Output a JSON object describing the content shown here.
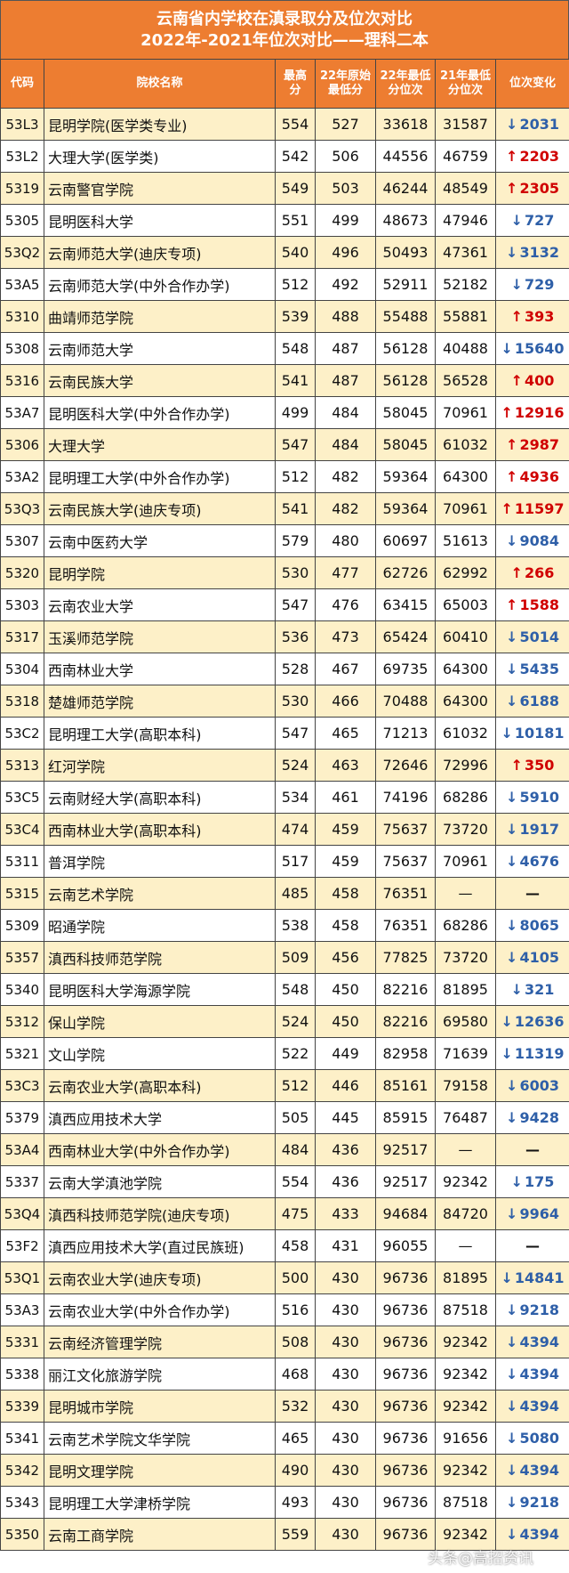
{
  "title": {
    "line1": "云南省内学校在滇录取分及位次对比",
    "line2": "2022年-2021年位次对比——理科二本"
  },
  "headers": [
    "代码",
    "院校名称",
    "最高分",
    "22年原始最低分",
    "22年最低分位次",
    "21年最低分位次",
    "位次变化"
  ],
  "colors": {
    "header": "#ed7d31",
    "stripe": "#fdf0c8",
    "up": "#d00000",
    "down": "#2e5fa8"
  },
  "watermark": "头条@高招资讯",
  "rows": [
    [
      "53L3",
      "昆明学院(医学类专业)",
      "554",
      "527",
      "33618",
      "31587",
      "down",
      "2031"
    ],
    [
      "53L2",
      "大理大学(医学类)",
      "542",
      "506",
      "44556",
      "46759",
      "up",
      "2203"
    ],
    [
      "5319",
      "云南警官学院",
      "549",
      "503",
      "46244",
      "48549",
      "up",
      "2305"
    ],
    [
      "5305",
      "昆明医科大学",
      "551",
      "499",
      "48673",
      "47946",
      "down",
      "727"
    ],
    [
      "53Q2",
      "云南师范大学(迪庆专项)",
      "540",
      "496",
      "50493",
      "47361",
      "down",
      "3132"
    ],
    [
      "53A5",
      "云南师范大学(中外合作办学)",
      "512",
      "492",
      "52911",
      "52182",
      "down",
      "729"
    ],
    [
      "5310",
      "曲靖师范学院",
      "539",
      "488",
      "55488",
      "55881",
      "up",
      "393"
    ],
    [
      "5308",
      "云南师范大学",
      "548",
      "487",
      "56128",
      "40488",
      "down",
      "15640"
    ],
    [
      "5316",
      "云南民族大学",
      "541",
      "487",
      "56128",
      "56528",
      "up",
      "400"
    ],
    [
      "53A7",
      "昆明医科大学(中外合作办学)",
      "499",
      "484",
      "58045",
      "70961",
      "up",
      "12916"
    ],
    [
      "5306",
      "大理大学",
      "547",
      "484",
      "58045",
      "61032",
      "up",
      "2987"
    ],
    [
      "53A2",
      "昆明理工大学(中外合作办学)",
      "512",
      "482",
      "59364",
      "64300",
      "up",
      "4936"
    ],
    [
      "53Q3",
      "云南民族大学(迪庆专项)",
      "541",
      "482",
      "59364",
      "70961",
      "up",
      "11597"
    ],
    [
      "5307",
      "云南中医药大学",
      "579",
      "480",
      "60697",
      "51613",
      "down",
      "9084"
    ],
    [
      "5320",
      "昆明学院",
      "530",
      "477",
      "62726",
      "62992",
      "up",
      "266"
    ],
    [
      "5303",
      "云南农业大学",
      "547",
      "476",
      "63415",
      "65003",
      "up",
      "1588"
    ],
    [
      "5317",
      "玉溪师范学院",
      "536",
      "473",
      "65424",
      "60410",
      "down",
      "5014"
    ],
    [
      "5304",
      "西南林业大学",
      "528",
      "467",
      "69735",
      "64300",
      "down",
      "5435"
    ],
    [
      "5318",
      "楚雄师范学院",
      "530",
      "466",
      "70488",
      "64300",
      "down",
      "6188"
    ],
    [
      "53C2",
      "昆明理工大学(高职本科)",
      "547",
      "465",
      "71213",
      "61032",
      "down",
      "10181"
    ],
    [
      "5313",
      "红河学院",
      "524",
      "463",
      "72646",
      "72996",
      "up",
      "350"
    ],
    [
      "53C5",
      "云南财经大学(高职本科)",
      "534",
      "461",
      "74196",
      "68286",
      "down",
      "5910"
    ],
    [
      "53C4",
      "西南林业大学(高职本科)",
      "474",
      "459",
      "75637",
      "73720",
      "down",
      "1917"
    ],
    [
      "5311",
      "普洱学院",
      "517",
      "459",
      "75637",
      "70961",
      "down",
      "4676"
    ],
    [
      "5315",
      "云南艺术学院",
      "485",
      "458",
      "76351",
      "—",
      "none",
      "—"
    ],
    [
      "5309",
      "昭通学院",
      "538",
      "458",
      "76351",
      "68286",
      "down",
      "8065"
    ],
    [
      "5357",
      "滇西科技师范学院",
      "509",
      "456",
      "77825",
      "73720",
      "down",
      "4105"
    ],
    [
      "5340",
      "昆明医科大学海源学院",
      "548",
      "450",
      "82216",
      "81895",
      "down",
      "321"
    ],
    [
      "5312",
      "保山学院",
      "524",
      "450",
      "82216",
      "69580",
      "down",
      "12636"
    ],
    [
      "5321",
      "文山学院",
      "522",
      "449",
      "82958",
      "71639",
      "down",
      "11319"
    ],
    [
      "53C3",
      "云南农业大学(高职本科)",
      "512",
      "446",
      "85161",
      "79158",
      "down",
      "6003"
    ],
    [
      "5379",
      "滇西应用技术大学",
      "505",
      "445",
      "85915",
      "76487",
      "down",
      "9428"
    ],
    [
      "53A4",
      "西南林业大学(中外合作办学)",
      "484",
      "436",
      "92517",
      "—",
      "none",
      "—"
    ],
    [
      "5337",
      "云南大学滇池学院",
      "554",
      "436",
      "92517",
      "92342",
      "down",
      "175"
    ],
    [
      "53Q4",
      "滇西科技师范学院(迪庆专项)",
      "475",
      "433",
      "94684",
      "84720",
      "down",
      "9964"
    ],
    [
      "53F2",
      "滇西应用技术大学(直过民族班)",
      "458",
      "431",
      "96055",
      "—",
      "none",
      "—"
    ],
    [
      "53Q1",
      "云南农业大学(迪庆专项)",
      "500",
      "430",
      "96736",
      "81895",
      "down",
      "14841"
    ],
    [
      "53A3",
      "云南农业大学(中外合作办学)",
      "516",
      "430",
      "96736",
      "87518",
      "down",
      "9218"
    ],
    [
      "5331",
      "云南经济管理学院",
      "508",
      "430",
      "96736",
      "92342",
      "down",
      "4394"
    ],
    [
      "5338",
      "丽江文化旅游学院",
      "468",
      "430",
      "96736",
      "92342",
      "down",
      "4394"
    ],
    [
      "5339",
      "昆明城市学院",
      "532",
      "430",
      "96736",
      "92342",
      "down",
      "4394"
    ],
    [
      "5341",
      "云南艺术学院文华学院",
      "465",
      "430",
      "96736",
      "91656",
      "down",
      "5080"
    ],
    [
      "5342",
      "昆明文理学院",
      "490",
      "430",
      "96736",
      "92342",
      "down",
      "4394"
    ],
    [
      "5343",
      "昆明理工大学津桥学院",
      "493",
      "430",
      "96736",
      "87518",
      "down",
      "9218"
    ],
    [
      "5350",
      "云南工商学院",
      "559",
      "430",
      "96736",
      "92342",
      "down",
      "4394"
    ]
  ]
}
